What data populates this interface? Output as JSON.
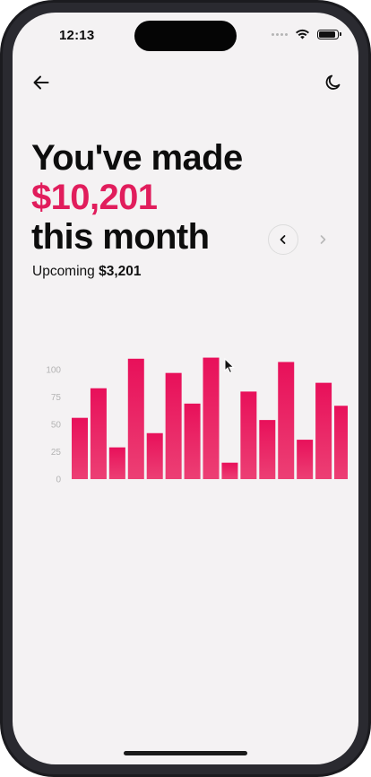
{
  "status_bar": {
    "time": "12:13",
    "icons": [
      "signal-dots-icon",
      "wifi-icon",
      "battery-icon"
    ]
  },
  "nav": {
    "back_icon": "arrow-left-icon",
    "theme_icon": "moon-icon"
  },
  "headline": {
    "line1": "You've made",
    "amount": "$10,201",
    "line3": "this month"
  },
  "upcoming": {
    "label": "Upcoming",
    "amount": "$3,201"
  },
  "pager": {
    "prev_icon": "chevron-left-icon",
    "next_icon": "chevron-right-icon"
  },
  "colors": {
    "accent": "#e11d5c",
    "bar_top": "#e8105a",
    "bar_bottom": "#ec3f74",
    "background": "#f4f2f3"
  },
  "chart_data": {
    "type": "bar",
    "title": "",
    "xlabel": "",
    "ylabel": "",
    "ylim": [
      0,
      100
    ],
    "yticks": [
      "0",
      "25",
      "50",
      "75",
      "100"
    ],
    "grid": false,
    "values": [
      56,
      83,
      29,
      110,
      42,
      97,
      69,
      111,
      15,
      80,
      54,
      107,
      36,
      88,
      67
    ]
  }
}
